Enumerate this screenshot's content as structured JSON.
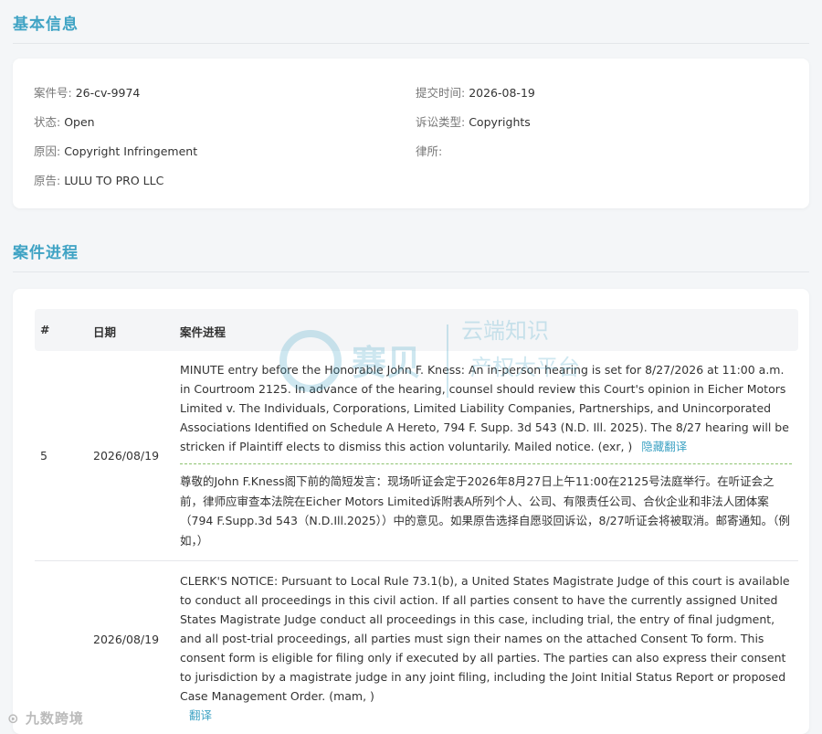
{
  "basic": {
    "title": "基本信息",
    "case_no_label": "案件号:",
    "case_no": "26-cv-9974",
    "submit_label": "提交时间:",
    "submit_time": "2026-08-19",
    "status_label": "状态:",
    "status": "Open",
    "type_label": "诉讼类型:",
    "type": "Copyrights",
    "cause_label": "原因:",
    "cause": "Copyright Infringement",
    "firm_label": "律所:",
    "firm": "",
    "plaintiff_label": "原告:",
    "plaintiff": "LULU TO PRO LLC"
  },
  "progress": {
    "title": "案件进程",
    "col_num": "#",
    "col_date": "日期",
    "col_progress": "案件进程",
    "rows": [
      {
        "num": "5",
        "date": "2026/08/19",
        "text": "MINUTE entry before the Honorable John F. Kness: An in-person hearing is set for 8/27/2026 at 11:00 a.m. in Courtroom 2125. In advance of the hearing, counsel should review this Court's opinion in Eicher Motors Limited v. The Individuals, Corporations, Limited Liability Companies, Partnerships, and Unincorporated Associations Identified on Schedule A Hereto, 794 F. Supp. 3d 543 (N.D. Ill. 2025). The 8/27 hearing will be stricken if Plaintiff elects to dismiss this action voluntarily. Mailed notice. (exr, )",
        "link": "隐藏翻译",
        "translation": "尊敬的John F.Kness阁下前的简短发言：现场听证会定于2026年8月27日上午11:00在2125号法庭举行。在听证会之前，律师应审查本法院在Eicher Motors Limited诉附表A所列个人、公司、有限责任公司、合伙企业和非法人团体案（794 F.Supp.3d 543（N.D.Ill.2025））中的意见。如果原告选择自愿驳回诉讼，8/27听证会将被取消。邮寄通知。（例如，）"
      },
      {
        "num": "",
        "date": "2026/08/19",
        "text": "CLERK'S NOTICE: Pursuant to Local Rule 73.1(b), a United States Magistrate Judge of this court is available to conduct all proceedings in this civil action. If all parties consent to have the currently assigned United States Magistrate Judge conduct all proceedings in this case, including trial, the entry of final judgment, and all post-trial proceedings, all parties must sign their names on the attached Consent To form. This consent form is eligible for filing only if executed by all parties. The parties can also express their consent to jurisdiction by a magistrate judge in any joint filing, including the Joint Initial Status Report or proposed Case Management Order. (mam, )",
        "link": "翻译"
      }
    ]
  },
  "watermark": {
    "brand": "赛贝",
    "line1": "云端知识",
    "line2": "产权大平台"
  },
  "footer_watermark": "九数跨境",
  "colors": {
    "accent": "#3fa3c4",
    "dashed": "#8dc26f"
  }
}
